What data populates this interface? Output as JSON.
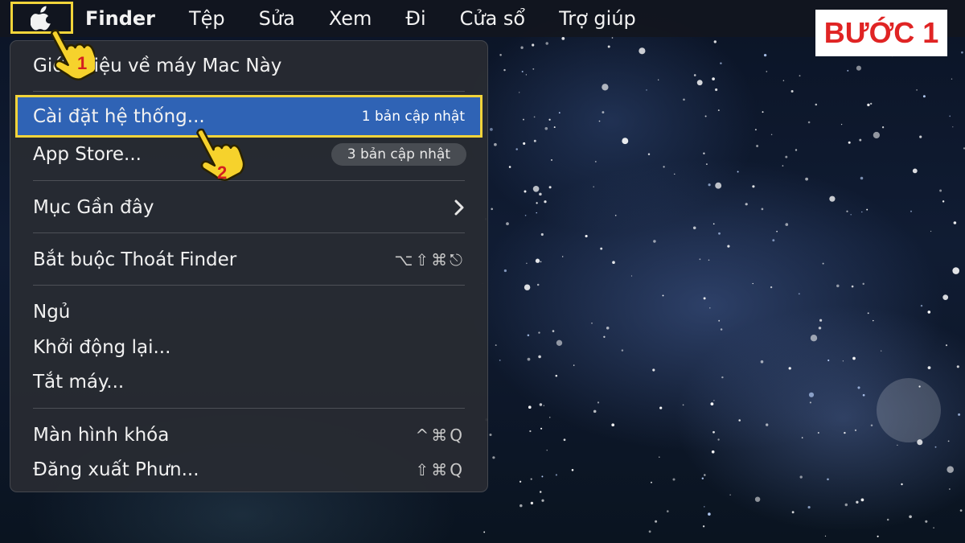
{
  "menubar": {
    "apple_icon": "apple-logo-icon",
    "items": [
      "Finder",
      "Tệp",
      "Sửa",
      "Xem",
      "Đi",
      "Cửa sổ",
      "Trợ giúp"
    ]
  },
  "step_badge": "BƯỚC 1",
  "apple_menu": {
    "about": "Giới thiệu về máy Mac Này",
    "system_settings": "Cài đặt hệ thống...",
    "system_settings_badge": "1 bản cập nhật",
    "app_store": "App Store...",
    "app_store_badge": "3 bản cập nhật",
    "recent_items": "Mục Gần đây",
    "force_quit": "Bắt buộc Thoát Finder",
    "force_quit_shortcut": "⌥⇧⌘⎋",
    "sleep": "Ngủ",
    "restart": "Khởi động lại...",
    "shutdown": "Tắt máy...",
    "lock_screen": "Màn hình khóa",
    "lock_screen_shortcut": "^⌘Q",
    "logout": "Đăng xuất Phưn...",
    "logout_shortcut": "⇧⌘Q"
  },
  "pointers": {
    "step1": "1",
    "step2": "2",
    "icon": "pointing-hand-icon"
  },
  "colors": {
    "highlight": "#2f63b5",
    "callout_border": "#f2d43a",
    "badge_text": "#e02424"
  }
}
